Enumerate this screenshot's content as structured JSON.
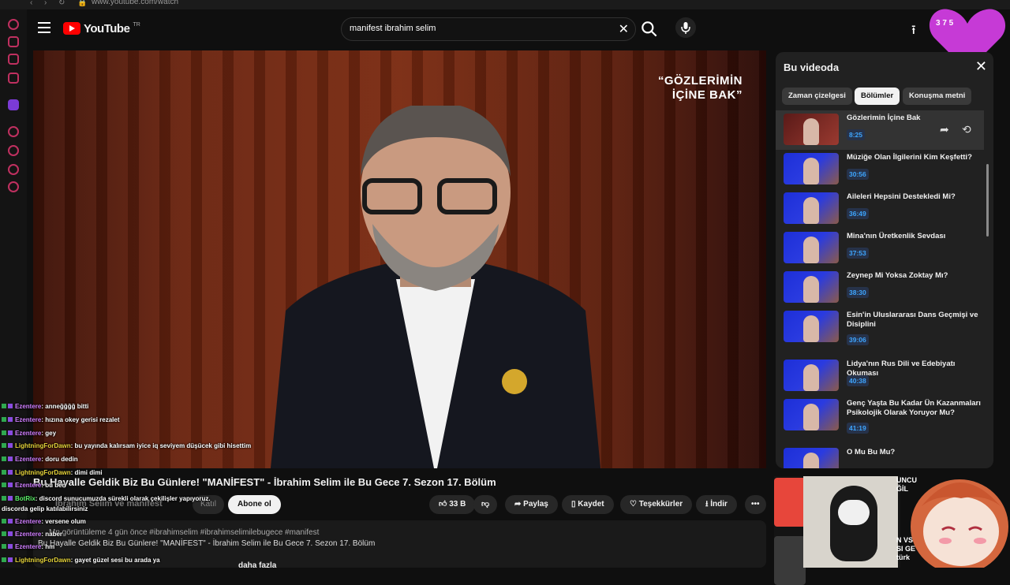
{
  "browser": {
    "url": "www.youtube.com/watch"
  },
  "header": {
    "logo_text": "YouTube",
    "region": "TR",
    "search_value": "manifest ibrahim selim"
  },
  "overlay": {
    "heart_stats": "3  7  5"
  },
  "video": {
    "overlay_title_line1": "“GÖZLERİMİN",
    "overlay_title_line2": "İÇİNE BAK”"
  },
  "panel": {
    "title": "Bu videoda",
    "tabs": [
      "Zaman çizelgesi",
      "Bölümler",
      "Konuşma metni"
    ],
    "active_tab": "Bölümler",
    "chapters": [
      {
        "title": "Gözlerimin İçine Bak",
        "time": "8:25"
      },
      {
        "title": "Müziğe Olan İlgilerini Kim Keşfetti?",
        "time": "30:56"
      },
      {
        "title": "Aileleri Hepsini Destekledi Mi?",
        "time": "36:49"
      },
      {
        "title": "Mina'nın Üretkenlik Sevdası",
        "time": "37:53"
      },
      {
        "title": "Zeynep Mi Yoksa Zoktay Mı?",
        "time": "38:30"
      },
      {
        "title": "Esin'in Uluslararası Dans Geçmişi ve Disiplini",
        "time": "39:06"
      },
      {
        "title": "Lidya'nın Rus Dili ve Edebiyatı Okuması",
        "time": "40:38"
      },
      {
        "title": "Genç Yaşta Bu Kadar Ün Kazanmaları Psikolojik Olarak Yoruyor Mu?",
        "time": "41:19"
      },
      {
        "title": "O Mu Bu Mu?",
        "time": ""
      }
    ]
  },
  "below": {
    "title": "Bu Hayalle Geldik Biz Bu Günlere! \"MANİFEST\" - İbrahim Selim ile Bu Gece 7. Sezon 17. Bölüm",
    "channel": "İbrahim Selim ve manifest",
    "join": "Katıl",
    "subscribe": "Abone ol",
    "likes": "33 B",
    "share": "Paylaş",
    "save": "Kaydet",
    "thanks": "Teşekkürler",
    "download": "İndir",
    "meta": "Mn görüntüleme  4 gün önce  #ibrahimselim #ibrahimselimilebugece #manifest",
    "desc": "Bu Hayalle Geldik Biz Bu Günlere! \"MANİFEST\" - İbrahim Selim ile Bu Gece 7. Sezon 17. Bölüm",
    "more": "daha fazla"
  },
  "chat": [
    {
      "user": "Ezentere",
      "msg": ": anneğğğğ bitti"
    },
    {
      "user": "Ezentere",
      "msg": ": hızına okey gerisi rezalet"
    },
    {
      "user": "Ezentere",
      "msg": ": gey"
    },
    {
      "user": "LightningForDawn",
      "msg": ": bu yayında kalırsam iyice iq seviyem düşücek gibi hisettim"
    },
    {
      "user": "Ezentere",
      "msg": ": doru dedin"
    },
    {
      "user": "LightningForDawn",
      "msg": ": dimi dimi"
    },
    {
      "user": "Ezentere",
      "msg": ": bu ben"
    },
    {
      "user": "BotRix",
      "msg": ": discord sunucumuzda sürekli olarak çekilişler yapıyoruz."
    },
    {
      "user": "",
      "msg": "discorda gelip katılabilirsiniz"
    },
    {
      "user": "Ezentere",
      "msg": ": versene olum"
    },
    {
      "user": "Ezentere",
      "msg": ": naber"
    },
    {
      "user": "Ezentere",
      "msg": ": hm"
    },
    {
      "user": "LightningForDawn",
      "msg": ": gayet güzel sesi bu arada ya"
    }
  ],
  "recs": {
    "line1": "UNCU",
    "line2": "ĞİL",
    "line3": "N VS",
    "line4": "SI GE",
    "line5": "türk"
  }
}
